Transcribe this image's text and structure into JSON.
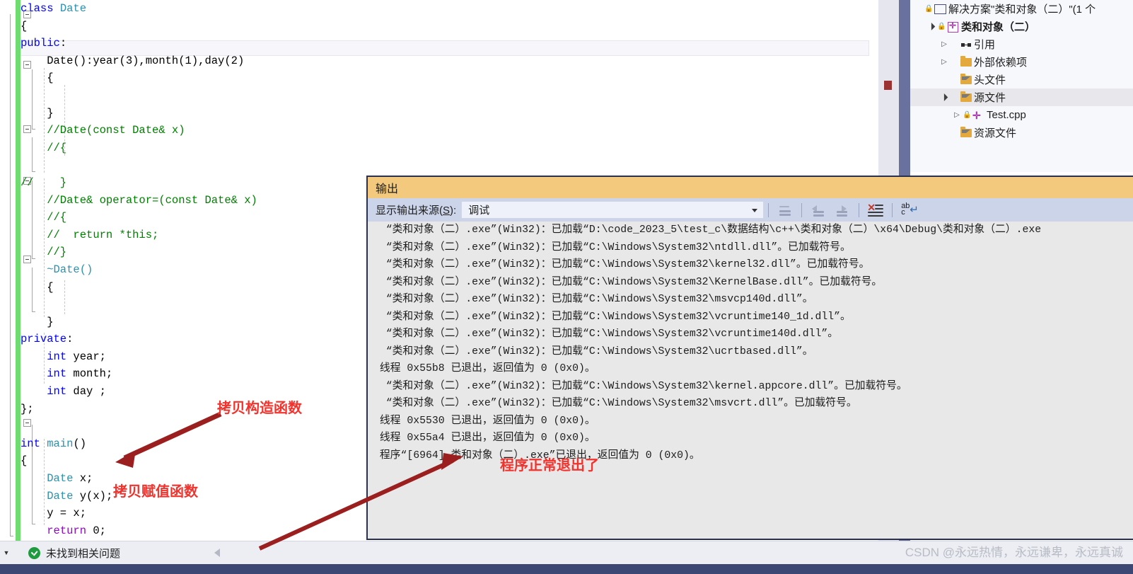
{
  "editor": {
    "lines": [
      {
        "fold": true,
        "segs": [
          {
            "t": "class ",
            "c": "kw"
          },
          {
            "t": "Date",
            "c": "type"
          }
        ]
      },
      {
        "segs": [
          {
            "t": "{",
            "c": ""
          }
        ]
      },
      {
        "highlight": true,
        "segs": [
          {
            "t": "public",
            "c": "kw"
          },
          {
            "t": ":",
            "c": ""
          }
        ]
      },
      {
        "fold": true,
        "segs": [
          {
            "t": "    Date():year(3),month(1),day(2)",
            "c": ""
          }
        ]
      },
      {
        "segs": [
          {
            "t": "    {",
            "c": ""
          }
        ]
      },
      {
        "segs": [
          {
            "t": "",
            "c": ""
          }
        ]
      },
      {
        "segs": [
          {
            "t": "    }",
            "c": ""
          }
        ]
      },
      {
        "fold": true,
        "segs": [
          {
            "t": "    //Date(const Date& x)",
            "c": "cmt"
          }
        ]
      },
      {
        "segs": [
          {
            "t": "    //{",
            "c": "cmt"
          }
        ]
      },
      {
        "segs": [
          {
            "t": "",
            "c": ""
          }
        ]
      },
      {
        "fold": true,
        "segs": [
          {
            "t": "//    }",
            "c": "cmt"
          }
        ]
      },
      {
        "segs": [
          {
            "t": "    //Date& operator=(const Date& x)",
            "c": "cmt"
          }
        ]
      },
      {
        "segs": [
          {
            "t": "    //{",
            "c": "cmt"
          }
        ]
      },
      {
        "segs": [
          {
            "t": "    //  return *this;",
            "c": "cmt"
          }
        ]
      },
      {
        "segs": [
          {
            "t": "    //}",
            "c": "cmt"
          }
        ]
      },
      {
        "fold": true,
        "segs": [
          {
            "t": "    ~Date()",
            "c": "type"
          }
        ]
      },
      {
        "segs": [
          {
            "t": "    {",
            "c": ""
          }
        ]
      },
      {
        "segs": [
          {
            "t": "",
            "c": ""
          }
        ]
      },
      {
        "segs": [
          {
            "t": "    }",
            "c": ""
          }
        ]
      },
      {
        "segs": [
          {
            "t": "private",
            "c": "kw"
          },
          {
            "t": ":",
            "c": ""
          }
        ]
      },
      {
        "segs": [
          {
            "t": "    ",
            "c": ""
          },
          {
            "t": "int",
            "c": "kw"
          },
          {
            "t": " year;",
            "c": ""
          }
        ]
      },
      {
        "segs": [
          {
            "t": "    ",
            "c": ""
          },
          {
            "t": "int",
            "c": "kw"
          },
          {
            "t": " month;",
            "c": ""
          }
        ]
      },
      {
        "segs": [
          {
            "t": "    ",
            "c": ""
          },
          {
            "t": "int",
            "c": "kw"
          },
          {
            "t": " day ;",
            "c": ""
          }
        ]
      },
      {
        "segs": [
          {
            "t": "};",
            "c": ""
          }
        ]
      },
      {
        "segs": [
          {
            "t": "",
            "c": ""
          }
        ]
      },
      {
        "fold": true,
        "segs": [
          {
            "t": "int",
            "c": "kw"
          },
          {
            "t": " ",
            "c": ""
          },
          {
            "t": "main",
            "c": "type"
          },
          {
            "t": "()",
            "c": ""
          }
        ]
      },
      {
        "segs": [
          {
            "t": "{",
            "c": ""
          }
        ]
      },
      {
        "segs": [
          {
            "t": "    ",
            "c": ""
          },
          {
            "t": "Date",
            "c": "type"
          },
          {
            "t": " x;",
            "c": ""
          }
        ]
      },
      {
        "segs": [
          {
            "t": "    ",
            "c": ""
          },
          {
            "t": "Date",
            "c": "type"
          },
          {
            "t": " y(x);",
            "c": ""
          }
        ]
      },
      {
        "segs": [
          {
            "t": "    y = x;",
            "c": ""
          }
        ]
      },
      {
        "segs": [
          {
            "t": "    ",
            "c": ""
          },
          {
            "t": "return",
            "c": "ctl"
          },
          {
            "t": " 0;",
            "c": ""
          }
        ]
      },
      {
        "segs": [
          {
            "t": "}",
            "c": ""
          }
        ]
      }
    ]
  },
  "solution": {
    "rows": [
      {
        "indent": 0,
        "chevron": "none",
        "icon": "vs-solution-icon",
        "label": "解决方案\"类和对象（二）\"(1 个",
        "bold": false,
        "lock": true,
        "selected": false
      },
      {
        "indent": 1,
        "chevron": "open",
        "icon": "project-icon",
        "label": "类和对象（二）",
        "bold": true,
        "lock": true,
        "selected": false
      },
      {
        "indent": 2,
        "chevron": "closed",
        "icon": "references-icon",
        "label": "引用",
        "bold": false,
        "lock": false,
        "selected": false
      },
      {
        "indent": 2,
        "chevron": "closed",
        "icon": "external-deps-icon",
        "label": "外部依赖项",
        "bold": false,
        "lock": false,
        "selected": false
      },
      {
        "indent": 2,
        "chevron": "none",
        "icon": "filter-folder-icon",
        "label": "头文件",
        "bold": false,
        "lock": false,
        "selected": false
      },
      {
        "indent": 2,
        "chevron": "open",
        "icon": "filter-folder-icon",
        "label": "源文件",
        "bold": false,
        "lock": false,
        "selected": true
      },
      {
        "indent": 3,
        "chevron": "closed",
        "icon": "cpp-file-icon",
        "label": "Test.cpp",
        "bold": false,
        "lock": true,
        "selected": false
      },
      {
        "indent": 2,
        "chevron": "none",
        "icon": "filter-folder-icon",
        "label": "资源文件",
        "bold": false,
        "lock": false,
        "selected": false
      }
    ]
  },
  "output": {
    "title": "输出",
    "source_label_pre": "显示输出来源(",
    "source_label_key": "S",
    "source_label_post": "):",
    "source_value": "调试",
    "toolbar_icons": [
      "clear-all-icon",
      "go-to-previous-icon",
      "go-to-next-icon",
      "clear-output-icon",
      "toggle-word-wrap-icon"
    ],
    "lines": [
      "  “类和对象（二）.exe”(Win32)：已加载“D:\\code_2023_5\\test_c\\数据结构\\c++\\类和对象（二）\\x64\\Debug\\类和对象（二）.exe",
      "  “类和对象（二）.exe”(Win32)：已加载“C:\\Windows\\System32\\ntdll.dll”。已加载符号。",
      "  “类和对象（二）.exe”(Win32)：已加载“C:\\Windows\\System32\\kernel32.dll”。已加载符号。",
      "  “类和对象（二）.exe”(Win32)：已加载“C:\\Windows\\System32\\KernelBase.dll”。已加载符号。",
      "  “类和对象（二）.exe”(Win32)：已加载“C:\\Windows\\System32\\msvcp140d.dll”。",
      "  “类和对象（二）.exe”(Win32)：已加载“C:\\Windows\\System32\\vcruntime140_1d.dll”。",
      "  “类和对象（二）.exe”(Win32)：已加载“C:\\Windows\\System32\\vcruntime140d.dll”。",
      "  “类和对象（二）.exe”(Win32)：已加载“C:\\Windows\\System32\\ucrtbased.dll”。",
      " 线程 0x55b8 已退出，返回值为 0 (0x0)。",
      "  “类和对象（二）.exe”(Win32)：已加载“C:\\Windows\\System32\\kernel.appcore.dll”。已加载符号。",
      "  “类和对象（二）.exe”(Win32)：已加载“C:\\Windows\\System32\\msvcrt.dll”。已加载符号。",
      " 线程 0x5530 已退出，返回值为 0 (0x0)。",
      " 线程 0x55a4 已退出，返回值为 0 (0x0)。",
      " 程序“[6964] 类和对象（二）.exe”已退出，返回值为 0 (0x0)。"
    ]
  },
  "annotations": {
    "copy_constructor": "拷贝构造函数",
    "copy_assignment": "拷贝赋值函数",
    "program_exited": "程序正常退出了",
    "color": "#f2332d",
    "arrow_color": "#9b1f1f"
  },
  "status": {
    "message": "未找到相关问题"
  },
  "watermark": {
    "text": "CSDN @永远热情，永远谦卑，永远真诚"
  }
}
